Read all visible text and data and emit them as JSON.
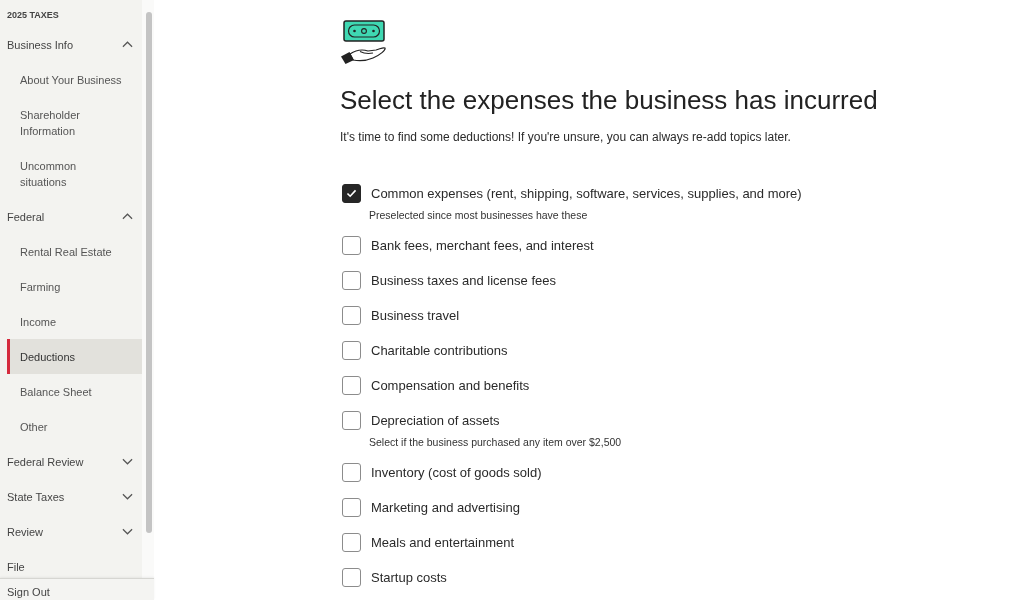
{
  "sidebar": {
    "title": "2025 TAXES",
    "sections": [
      {
        "label": "Business Info",
        "kind": "group",
        "expanded": true,
        "children": [
          {
            "label": "About Your Business",
            "selected": false
          },
          {
            "label": "Shareholder Information",
            "selected": false
          },
          {
            "label": "Uncommon situations",
            "selected": false
          }
        ]
      },
      {
        "label": "Federal",
        "kind": "group",
        "expanded": true,
        "children": [
          {
            "label": "Rental Real Estate",
            "selected": false
          },
          {
            "label": "Farming",
            "selected": false
          },
          {
            "label": "Income",
            "selected": false
          },
          {
            "label": "Deductions",
            "selected": true
          },
          {
            "label": "Balance Sheet",
            "selected": false
          },
          {
            "label": "Other",
            "selected": false
          }
        ]
      },
      {
        "label": "Federal Review",
        "kind": "group",
        "expanded": false
      },
      {
        "label": "State Taxes",
        "kind": "group",
        "expanded": false
      },
      {
        "label": "Review",
        "kind": "group",
        "expanded": false
      },
      {
        "label": "File",
        "kind": "link"
      }
    ],
    "sign_out": "Sign Out"
  },
  "page": {
    "title": "Select the expenses the business has incurred",
    "subtitle": "It's time to find some deductions! If you're unsure, you can always re-add topics later.",
    "expenses": [
      {
        "label": "Common expenses (rent, shipping, software, services, supplies, and more)",
        "checked": true,
        "hint": "Preselected since most businesses have these"
      },
      {
        "label": "Bank fees, merchant fees, and interest",
        "checked": false
      },
      {
        "label": "Business taxes and license fees",
        "checked": false
      },
      {
        "label": "Business travel",
        "checked": false
      },
      {
        "label": "Charitable contributions",
        "checked": false
      },
      {
        "label": "Compensation and benefits",
        "checked": false
      },
      {
        "label": "Depreciation of assets",
        "checked": false,
        "hint": "Select if the business purchased any item over $2,500"
      },
      {
        "label": "Inventory (cost of goods sold)",
        "checked": false
      },
      {
        "label": "Marketing and advertising",
        "checked": false
      },
      {
        "label": "Meals and entertainment",
        "checked": false
      },
      {
        "label": "Startup costs",
        "checked": false
      }
    ]
  }
}
